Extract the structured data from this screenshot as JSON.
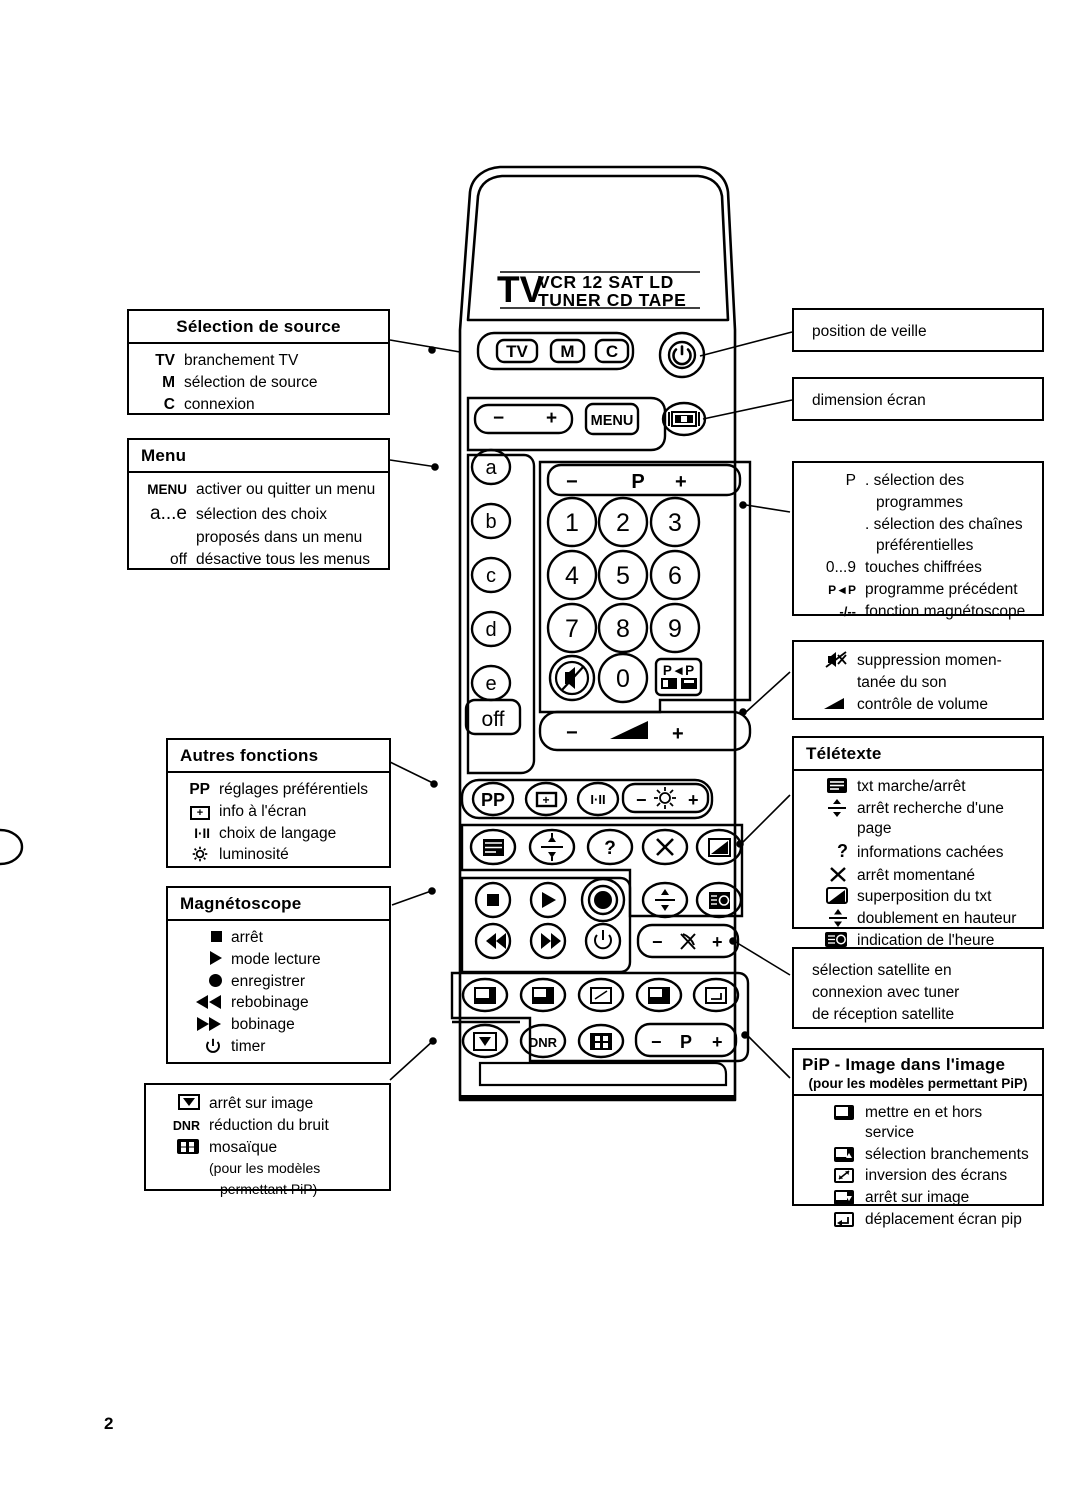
{
  "page": {
    "number": "2"
  },
  "remote": {
    "display": {
      "primary": "TV",
      "line1": "VCR 12  SAT  LD",
      "line2": "TUNER CD TAPE"
    },
    "source_buttons": [
      "TV",
      "M",
      "C"
    ],
    "standby_icon": "power-icon",
    "screen_format_icon": "screen-format-icon",
    "menu_row": {
      "minus": "−",
      "plus": "+",
      "menu": "MENU"
    },
    "letter_buttons": [
      "a",
      "b",
      "c",
      "d",
      "e"
    ],
    "off_button": "off",
    "program_bar": {
      "minus": "−",
      "label": "P",
      "plus": "+"
    },
    "number_buttons": [
      "1",
      "2",
      "3",
      "4",
      "5",
      "6",
      "7",
      "8",
      "9",
      "0"
    ],
    "mute_icon": "mute-icon",
    "prev_program_button": "P◄P",
    "volume_bar": {
      "minus": "−",
      "icon": "volume-icon",
      "plus": "+"
    },
    "other_row": {
      "pp": "PP",
      "osd_icon": "osd-plus-icon",
      "language": "I·II",
      "bright_minus": "−",
      "bright_icon": "brightness-icon",
      "bright_plus": "+"
    },
    "teletext_row": [
      "text-icon",
      "page-hold-icon",
      "reveal-icon",
      "freeze-x-icon",
      "mix-icon"
    ],
    "vcr_row1": [
      "stop-icon",
      "play-icon",
      "record-icon"
    ],
    "vcr_row2": [
      "rewind-icon",
      "fast-forward-icon",
      "timer-icon"
    ],
    "teletext_row2": [
      "double-height-icon",
      "clock-icon"
    ],
    "satellite_bar": {
      "minus": "−",
      "icon": "satellite-icon",
      "plus": "+"
    },
    "pip_row": [
      "pip-onoff-icon",
      "pip-source-icon",
      "pip-swap-icon",
      "pip-freeze-icon",
      "pip-move-icon"
    ],
    "pip_row2": [
      "freeze-frame-icon",
      "DNR",
      "mosaic-icon"
    ],
    "pip_program_bar": {
      "minus": "−",
      "label": "P",
      "plus": "+"
    }
  },
  "callouts": {
    "source": {
      "title": "Sélection de source",
      "items": [
        {
          "key": "TV",
          "value": "branchement TV"
        },
        {
          "key": "M",
          "value": "sélection de source"
        },
        {
          "key": "C",
          "value": "connexion"
        }
      ]
    },
    "menu": {
      "title": "Menu",
      "items": [
        {
          "key": "MENU",
          "value": "activer ou quitter un menu"
        },
        {
          "key": "a...e",
          "value": "sélection des choix"
        },
        {
          "key": "",
          "value": "proposés dans un menu"
        },
        {
          "key": "off",
          "value": "désactive tous les menus"
        }
      ]
    },
    "other_functions": {
      "title": "Autres fonctions",
      "items": [
        {
          "icon": "",
          "key": "PP",
          "value": "réglages préférentiels"
        },
        {
          "icon": "osd-plus-icon",
          "key": "",
          "value": "info à l'écran"
        },
        {
          "icon": "",
          "key": "I·II",
          "value": "choix de langage"
        },
        {
          "icon": "brightness-icon",
          "key": "",
          "value": "luminosité"
        }
      ]
    },
    "vcr": {
      "title": "Magnétoscope",
      "items": [
        {
          "icon": "stop-icon",
          "value": "arrêt"
        },
        {
          "icon": "play-icon",
          "value": "mode lecture"
        },
        {
          "icon": "record-icon",
          "value": "enregistrer"
        },
        {
          "icon": "rewind-icon",
          "value": "rebobinage"
        },
        {
          "icon": "fast-forward-icon",
          "value": "bobinage"
        },
        {
          "icon": "timer-icon",
          "value": "timer"
        }
      ]
    },
    "pip_bottom_left": {
      "items": [
        {
          "icon": "freeze-frame-icon",
          "key": "",
          "value": "arrêt sur image"
        },
        {
          "icon": "",
          "key": "DNR",
          "value": "réduction du bruit"
        },
        {
          "icon": "mosaic-icon",
          "key": "",
          "value": "mosaïque"
        }
      ],
      "note_line1": "(pour les modèles",
      "note_line2": "permettant PiP)"
    },
    "standby": {
      "text": "position de veille"
    },
    "screen_size": {
      "text": "dimension écran"
    },
    "program": {
      "items": [
        {
          "key": "P",
          "value": ". sélection des"
        },
        {
          "key": "",
          "value": "programmes"
        },
        {
          "key": "",
          "value": ". sélection des chaînes"
        },
        {
          "key": "",
          "value": "préférentielles"
        },
        {
          "key": "0...9",
          "value": "touches chiffrées"
        },
        {
          "key": "P◄P",
          "value": "programme précédent"
        },
        {
          "key": "-/--",
          "value": "fonction magnétoscope"
        }
      ]
    },
    "sound": {
      "items": [
        {
          "icon": "mute-icon",
          "value": "suppression momen-"
        },
        {
          "icon": "",
          "value": "tanée du son"
        },
        {
          "icon": "volume-icon",
          "value": "contrôle de volume"
        }
      ]
    },
    "teletext": {
      "title": "Télétexte",
      "items": [
        {
          "icon": "text-icon",
          "value": "txt marche/arrêt"
        },
        {
          "icon": "page-hold-icon",
          "value": "arrêt recherche d'une page"
        },
        {
          "icon": "reveal-icon",
          "value": "informations cachées"
        },
        {
          "icon": "freeze-x-icon",
          "value": "arrêt momentané"
        },
        {
          "icon": "mix-icon",
          "value": "superposition du txt"
        },
        {
          "icon": "double-height-icon",
          "value": "doublement en hauteur"
        },
        {
          "icon": "clock-icon",
          "value": "indication de l'heure"
        }
      ]
    },
    "satellite": {
      "line1": "sélection satellite en",
      "line2": "connexion avec tuner",
      "line3": "de réception satellite"
    },
    "pip": {
      "title": "PiP - Image dans l'image",
      "subtitle": "(pour les modèles permettant PiP)",
      "items": [
        {
          "icon": "pip-onoff-icon",
          "value": "mettre en et hors service"
        },
        {
          "icon": "pip-source-icon",
          "value": "sélection branchements"
        },
        {
          "icon": "pip-swap-icon",
          "value": "inversion des écrans"
        },
        {
          "icon": "pip-freeze-icon",
          "value": "arrêt sur image"
        },
        {
          "icon": "pip-move-icon",
          "value": "déplacement écran pip"
        }
      ]
    }
  }
}
